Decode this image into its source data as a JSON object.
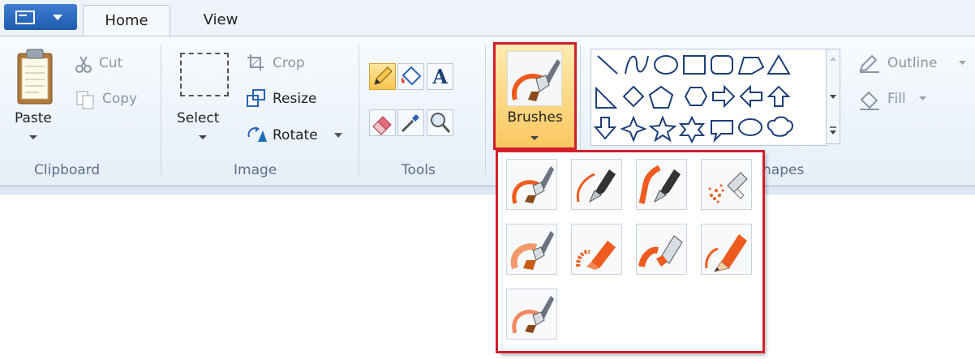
{
  "tabs": {
    "home": "Home",
    "view": "View"
  },
  "clipboard": {
    "paste": "Paste",
    "cut": "Cut",
    "copy": "Copy",
    "group": "Clipboard"
  },
  "image": {
    "select": "Select",
    "crop": "Crop",
    "resize": "Resize",
    "rotate": "Rotate",
    "group": "Image"
  },
  "tools": {
    "group": "Tools",
    "text_glyph": "A"
  },
  "brushes": {
    "label": "Brushes"
  },
  "shapes": {
    "outline": "Outline",
    "fill": "Fill",
    "group": "Shapes",
    "group_visible": "hapes"
  },
  "brush_menu": {
    "items": [
      {
        "icon": "brush-icon"
      },
      {
        "icon": "calligraphy-brush-1-icon"
      },
      {
        "icon": "calligraphy-brush-2-icon"
      },
      {
        "icon": "airbrush-icon"
      },
      {
        "icon": "oil-brush-icon"
      },
      {
        "icon": "crayon-icon"
      },
      {
        "icon": "marker-icon"
      },
      {
        "icon": "natural-pencil-icon"
      },
      {
        "icon": "watercolor-brush-icon"
      }
    ]
  },
  "colors": {
    "highlight": "#d21f2b",
    "accent": "#ee5b1f"
  }
}
